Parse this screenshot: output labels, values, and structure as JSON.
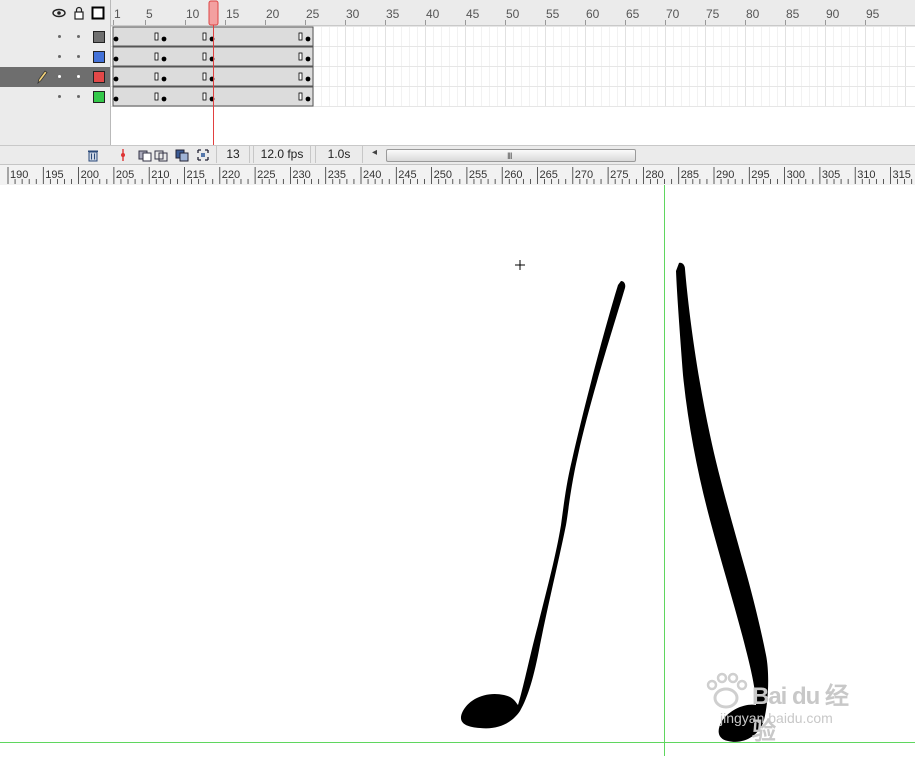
{
  "timeline": {
    "frame_ticks": [
      "1",
      "5",
      "10",
      "15",
      "20",
      "25",
      "30",
      "35",
      "40",
      "45",
      "50",
      "55",
      "60",
      "65",
      "70",
      "75",
      "80",
      "85",
      "90",
      "95"
    ],
    "current_frame": "13",
    "fps": "12.0 fps",
    "elapsed": "1.0s",
    "layers": [
      {
        "color": "#6f6f6f",
        "selected": false
      },
      {
        "color": "#4472d8",
        "selected": false
      },
      {
        "color": "#e34848",
        "selected": true
      },
      {
        "color": "#34c84a",
        "selected": false
      }
    ]
  },
  "ruler": {
    "labels": [
      "190",
      "195",
      "200",
      "205",
      "210",
      "215",
      "220",
      "225",
      "230",
      "235",
      "240",
      "245",
      "250",
      "255",
      "260",
      "265",
      "270",
      "275",
      "280",
      "285",
      "290",
      "295",
      "300",
      "305",
      "310",
      "315"
    ]
  },
  "watermark": {
    "brand": "Bai du 经验",
    "url": "jingyan.baidu.com"
  }
}
